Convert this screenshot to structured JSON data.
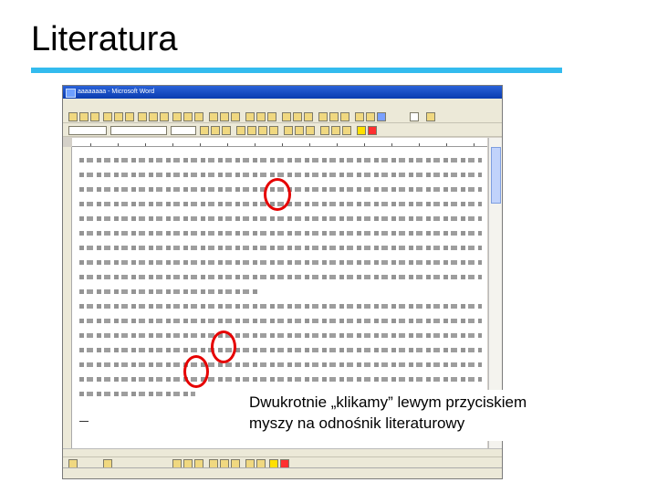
{
  "slide": {
    "title": "Literatura",
    "rule_color": "#33bbee"
  },
  "word_window": {
    "title": "aaaaaaaa - Microsoft Word",
    "font_size": "10"
  },
  "callout": {
    "line1": "Dwukrotnie „klikamy” lewym przyciskiem",
    "line2": "myszy na odnośnik literaturowy"
  },
  "annotation_color": "#e60000"
}
